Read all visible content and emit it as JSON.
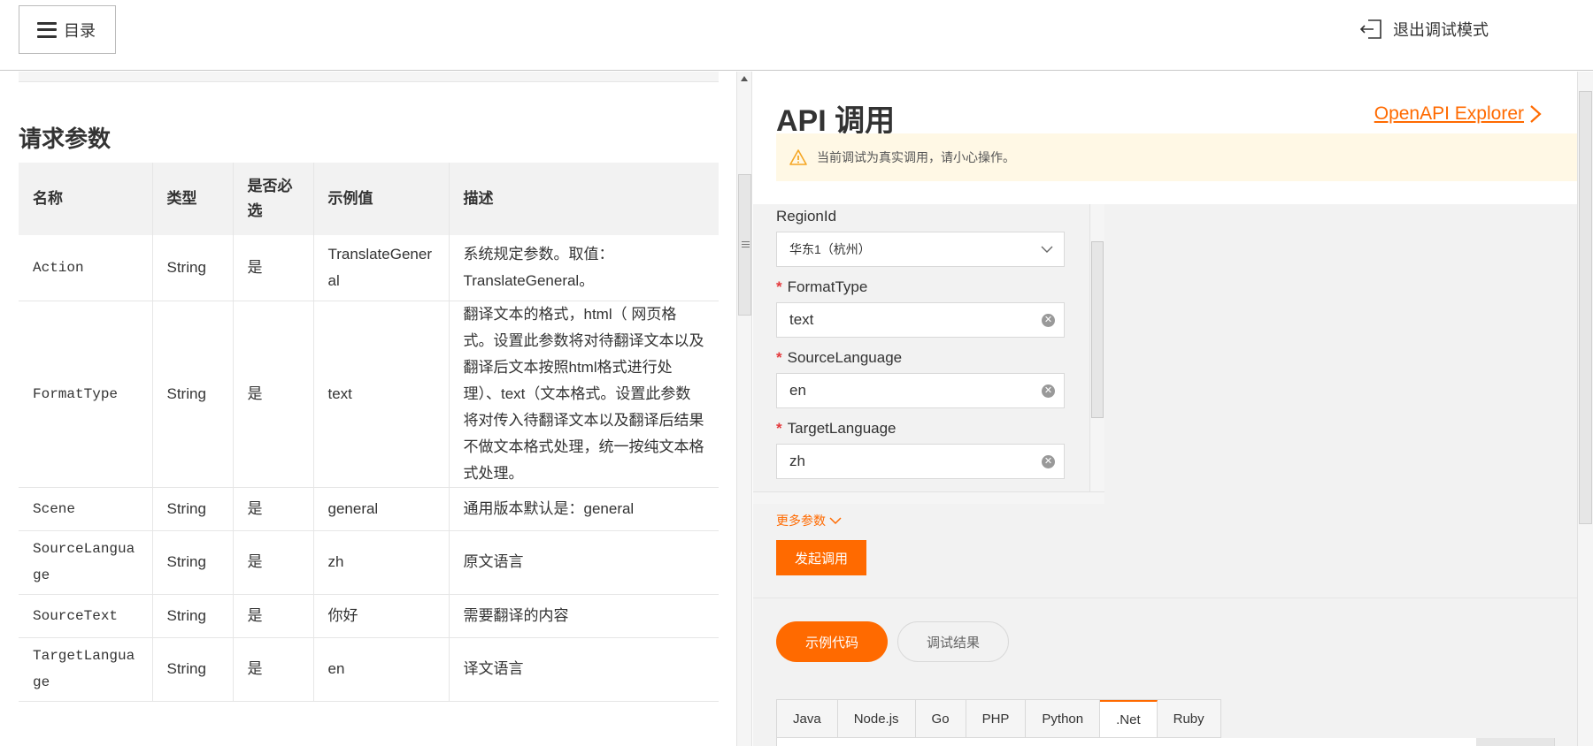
{
  "header": {
    "menu_label": "目录",
    "exit_label": "退出调试模式"
  },
  "doc": {
    "section_title": "请求参数",
    "columns": [
      "名称",
      "类型",
      "是否必选",
      "示例值",
      "描述"
    ],
    "rows": [
      {
        "name": "Action",
        "type": "String",
        "required": "是",
        "example": "TranslateGeneral",
        "desc": "系统规定参数。取值：TranslateGeneral。"
      },
      {
        "name": "FormatType",
        "type": "String",
        "required": "是",
        "example": "text",
        "desc": "翻译文本的格式，html（ 网页格式。设置此参数将对待翻译文本以及翻译后文本按照html格式进行处理）、text（文本格式。设置此参数将对传入待翻译文本以及翻译后结果不做文本格式处理，统一按纯文本格式处理。"
      },
      {
        "name": "Scene",
        "type": "String",
        "required": "是",
        "example": "general",
        "desc": "通用版本默认是：general"
      },
      {
        "name": "SourceLanguage",
        "type": "String",
        "required": "是",
        "example": "zh",
        "desc": "原文语言"
      },
      {
        "name": "SourceText",
        "type": "String",
        "required": "是",
        "example": "你好",
        "desc": "需要翻译的内容"
      },
      {
        "name": "TargetLanguage",
        "type": "String",
        "required": "是",
        "example": "en",
        "desc": "译文语言"
      }
    ]
  },
  "api": {
    "title": "API 调用",
    "explorer_link": "OpenAPI Explorer",
    "warning": "当前调试为真实调用，请小心操作。",
    "fields": {
      "region_label": "RegionId",
      "region_value": "华东1（杭州）",
      "format_label": "FormatType",
      "format_value": "text",
      "source_label": "SourceLanguage",
      "source_value": "en",
      "target_label": "TargetLanguage",
      "target_value": "zh",
      "required_mark": "*"
    },
    "more_params": "更多参数",
    "submit": "发起调用",
    "tabs": {
      "sample": "示例代码",
      "result": "调试结果"
    },
    "languages": [
      "Java",
      "Node.js",
      "Go",
      "PHP",
      "Python",
      ".Net",
      "Ruby"
    ],
    "active_language": ".Net",
    "accent_color": "#ff6a00"
  }
}
